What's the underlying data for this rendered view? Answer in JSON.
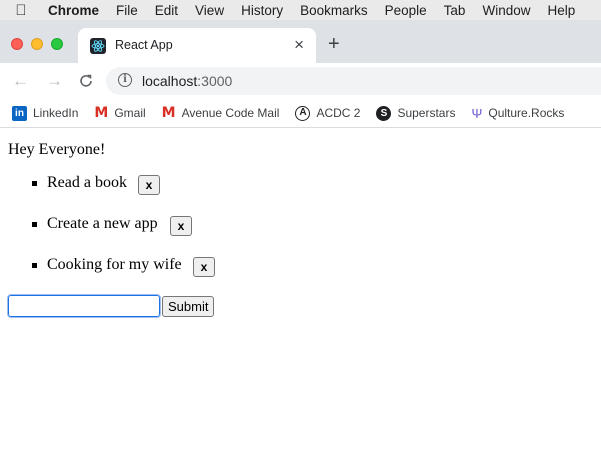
{
  "menubar": {
    "apple_icon": "apple-logo-icon",
    "app_name": "Chrome",
    "items": [
      "File",
      "Edit",
      "View",
      "History",
      "Bookmarks",
      "People",
      "Tab",
      "Window",
      "Help"
    ]
  },
  "browser": {
    "tab": {
      "title": "React App",
      "close": "×",
      "favicon": "react-logo-icon"
    },
    "new_tab": "+",
    "nav": {
      "back": "←",
      "forward": "→",
      "reload": "C"
    },
    "address": {
      "info_glyph": "i",
      "host": "localhost",
      "port": ":3000"
    }
  },
  "bookmarks": [
    {
      "label": "LinkedIn",
      "icon": "linkedin-icon",
      "glyph": "in"
    },
    {
      "label": "Gmail",
      "icon": "gmail-icon",
      "glyph": "M"
    },
    {
      "label": "Avenue Code Mail",
      "icon": "gmail-icon",
      "glyph": "M"
    },
    {
      "label": "ACDC 2",
      "icon": "a-circle-icon",
      "glyph": "A"
    },
    {
      "label": "Superstars",
      "icon": "s-circle-icon",
      "glyph": "S"
    },
    {
      "label": "Qulture.Rocks",
      "icon": "rock-hand-icon",
      "glyph": "Ψ"
    }
  ],
  "page": {
    "greeting": "Hey Everyone!",
    "todos": [
      {
        "text": "Read a book",
        "remove": "x"
      },
      {
        "text": "Create a new app",
        "remove": "x"
      },
      {
        "text": "Cooking for my wife",
        "remove": "x"
      }
    ],
    "input_value": "",
    "submit": "Submit"
  },
  "colors": {
    "focus": "#1a73e8",
    "tab_strip": "#dee1e6",
    "menubar": "#eaeaea"
  }
}
